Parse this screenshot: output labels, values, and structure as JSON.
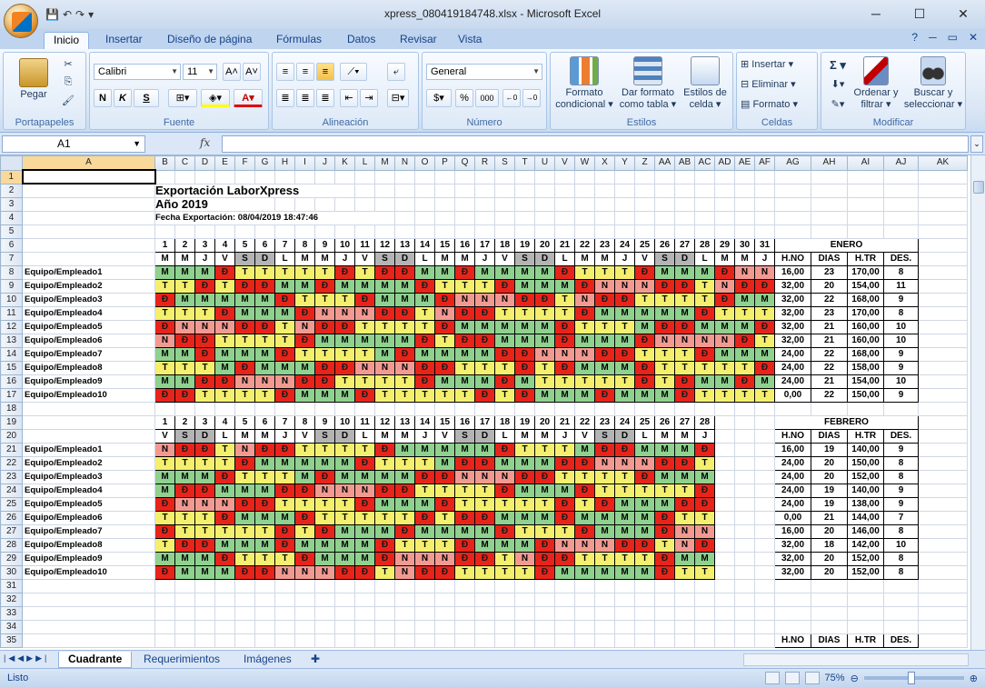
{
  "window": {
    "title": "xpress_080419184748.xlsx - Microsoft Excel",
    "minimize": "─",
    "maximize": "☐",
    "close": "✕"
  },
  "qat": {
    "save": "💾",
    "undo": "↶",
    "redo": "↷",
    "customize": "▾"
  },
  "ribbon_tabs": [
    "Inicio",
    "Insertar",
    "Diseño de página",
    "Fórmulas",
    "Datos",
    "Revisar",
    "Vista"
  ],
  "ribbon": {
    "portapapeles": {
      "title": "Portapapeles",
      "paste": "Pegar"
    },
    "fuente": {
      "title": "Fuente",
      "font": "Calibri",
      "size": "11",
      "bold": "N",
      "italic": "K",
      "underline": "S",
      "grow": "A˄",
      "shrink": "A˅"
    },
    "alineacion": {
      "title": "Alineación"
    },
    "numero": {
      "title": "Número",
      "format": "General",
      "percent": "%",
      "thousands": "000"
    },
    "estilos": {
      "title": "Estilos",
      "cond": "Formato condicional ▾",
      "table": "Dar formato como tabla ▾",
      "cell": "Estilos de celda ▾"
    },
    "celdas": {
      "title": "Celdas",
      "insert": "Insertar ▾",
      "delete": "Eliminar ▾",
      "format": "Formato ▾"
    },
    "modificar": {
      "title": "Modificar",
      "sum": "Σ ▾",
      "sort": "Ordenar y filtrar ▾",
      "find": "Buscar y seleccionar ▾"
    }
  },
  "formula_bar": {
    "name_box": "A1",
    "fx": "fx",
    "value": ""
  },
  "sheet": {
    "col_headers": [
      "A",
      "B",
      "C",
      "D",
      "E",
      "F",
      "G",
      "H",
      "I",
      "J",
      "K",
      "L",
      "M",
      "N",
      "O",
      "P",
      "Q",
      "R",
      "S",
      "T",
      "U",
      "V",
      "W",
      "X",
      "Y",
      "Z",
      "AA",
      "AB",
      "AC",
      "AD",
      "AE",
      "AF",
      "AG",
      "AH",
      "AI",
      "AJ",
      "AK"
    ],
    "title": "Exportación LaborXpress",
    "year": "Año 2019",
    "export_date": "Fecha Exportación: 08/04/2019 18:47:46",
    "stat_headers": [
      "H.NO",
      "DIAS",
      "H.TR",
      "DES."
    ],
    "employees": [
      "Equipo/Empleado1",
      "Equipo/Empleado2",
      "Equipo/Empleado3",
      "Equipo/Empleado4",
      "Equipo/Empleado5",
      "Equipo/Empleado6",
      "Equipo/Empleado7",
      "Equipo/Empleado8",
      "Equipo/Empleado9",
      "Equipo/Empleado10"
    ],
    "months": [
      {
        "name": "ENERO",
        "days": [
          "1",
          "2",
          "3",
          "4",
          "5",
          "6",
          "7",
          "8",
          "9",
          "10",
          "11",
          "12",
          "13",
          "14",
          "15",
          "16",
          "17",
          "18",
          "19",
          "20",
          "21",
          "22",
          "23",
          "24",
          "25",
          "26",
          "27",
          "28",
          "29",
          "30",
          "31"
        ],
        "weekdays": [
          "M",
          "M",
          "J",
          "V",
          "S",
          "D",
          "L",
          "M",
          "M",
          "J",
          "V",
          "S",
          "D",
          "L",
          "M",
          "M",
          "J",
          "V",
          "S",
          "D",
          "L",
          "M",
          "M",
          "J",
          "V",
          "S",
          "D",
          "L",
          "M",
          "M",
          "J"
        ],
        "rows": [
          "MMMDTTTTTDTDDMMDMMMMDTTTDMMMDNN",
          "TTDTDDMMDMMMMDTTTDMMMDNNNDDTNDD",
          "DMMMMMDTTTDMMMDNNNDDTNDDTTTTDMM",
          "TTTDMMMDNNNDDTNDDTTTTDMMMMMDTTT",
          "DNNNDDTNDDTTTTDMMMMMDTTTMDDMMMD",
          "NDDTTTTDMMMMMDTDDMMMDMMMDNNNNDT",
          "MMDMMMDTTTTMDMMMMDDNNNDDTTTDMMM",
          "TTTMDMMMDDNNNDDTTTDTDMMMDTTTTTD",
          "MMDDNNNDDTTTTDMMMDMTTTTTDTDMMDM",
          "DDTTTTDMMMDTTTTTDTDMMMDMMMDTTTT"
        ],
        "stats": [
          [
            "16,00",
            "23",
            "170,00",
            "8"
          ],
          [
            "32,00",
            "20",
            "154,00",
            "11"
          ],
          [
            "32,00",
            "22",
            "168,00",
            "9"
          ],
          [
            "32,00",
            "23",
            "170,00",
            "8"
          ],
          [
            "32,00",
            "21",
            "160,00",
            "10"
          ],
          [
            "32,00",
            "21",
            "160,00",
            "10"
          ],
          [
            "24,00",
            "22",
            "168,00",
            "9"
          ],
          [
            "24,00",
            "22",
            "158,00",
            "9"
          ],
          [
            "24,00",
            "21",
            "154,00",
            "10"
          ],
          [
            "0,00",
            "22",
            "150,00",
            "9"
          ]
        ]
      },
      {
        "name": "FEBRERO",
        "days": [
          "1",
          "2",
          "3",
          "4",
          "5",
          "6",
          "7",
          "8",
          "9",
          "10",
          "11",
          "12",
          "13",
          "14",
          "15",
          "16",
          "17",
          "18",
          "19",
          "20",
          "21",
          "22",
          "23",
          "24",
          "25",
          "26",
          "27",
          "28"
        ],
        "weekdays": [
          "V",
          "S",
          "D",
          "L",
          "M",
          "M",
          "J",
          "V",
          "S",
          "D",
          "L",
          "M",
          "M",
          "J",
          "V",
          "S",
          "D",
          "L",
          "M",
          "M",
          "J",
          "V",
          "S",
          "D",
          "L",
          "M",
          "M",
          "J"
        ],
        "rows": [
          "NDDTNDDTTTTDMMMMMDTTTMDDMMMD",
          "TTTTDMMMMMDTTTMDDMMMDDNNNDDT",
          "MMMDTTTMDMMMMDDNNNDDTTTTDMMM",
          "MDDMMMDDNNNDDTTTTDMMMDTTTTTD",
          "DNNNDDTTTTDMMMDTTTTTDTDMMMDD",
          "TTTDMMMDTTTTTDTDDMMMDMMMMDTT",
          "DTTTTTDTDMMMDMMMMDTTTDMMMDNN",
          "TDDMMMDMMMMDTTTDMMMDNNNDDTND",
          "MMMDTTTDMMMDNNNDDTNDDTTTTDMM",
          "DMMMDDNNNDDTNDDTTTTDMMMMMDTT"
        ],
        "stats": [
          [
            "16,00",
            "19",
            "140,00",
            "9"
          ],
          [
            "24,00",
            "20",
            "150,00",
            "8"
          ],
          [
            "24,00",
            "20",
            "152,00",
            "8"
          ],
          [
            "24,00",
            "19",
            "140,00",
            "9"
          ],
          [
            "24,00",
            "19",
            "138,00",
            "9"
          ],
          [
            "0,00",
            "21",
            "144,00",
            "7"
          ],
          [
            "16,00",
            "20",
            "146,00",
            "8"
          ],
          [
            "32,00",
            "18",
            "142,00",
            "10"
          ],
          [
            "32,00",
            "20",
            "152,00",
            "8"
          ],
          [
            "32,00",
            "20",
            "152,00",
            "8"
          ]
        ]
      }
    ],
    "colors": {
      "M": "#8fd18f",
      "T": "#f4f06e",
      "D": "#e8241a",
      "N": "#f29a92",
      "S": "#b4b4b4"
    }
  },
  "sheet_tabs": [
    "Cuadrante",
    "Requerimientos",
    "Imágenes"
  ],
  "status": {
    "text": "Listo",
    "zoom": "75%"
  }
}
